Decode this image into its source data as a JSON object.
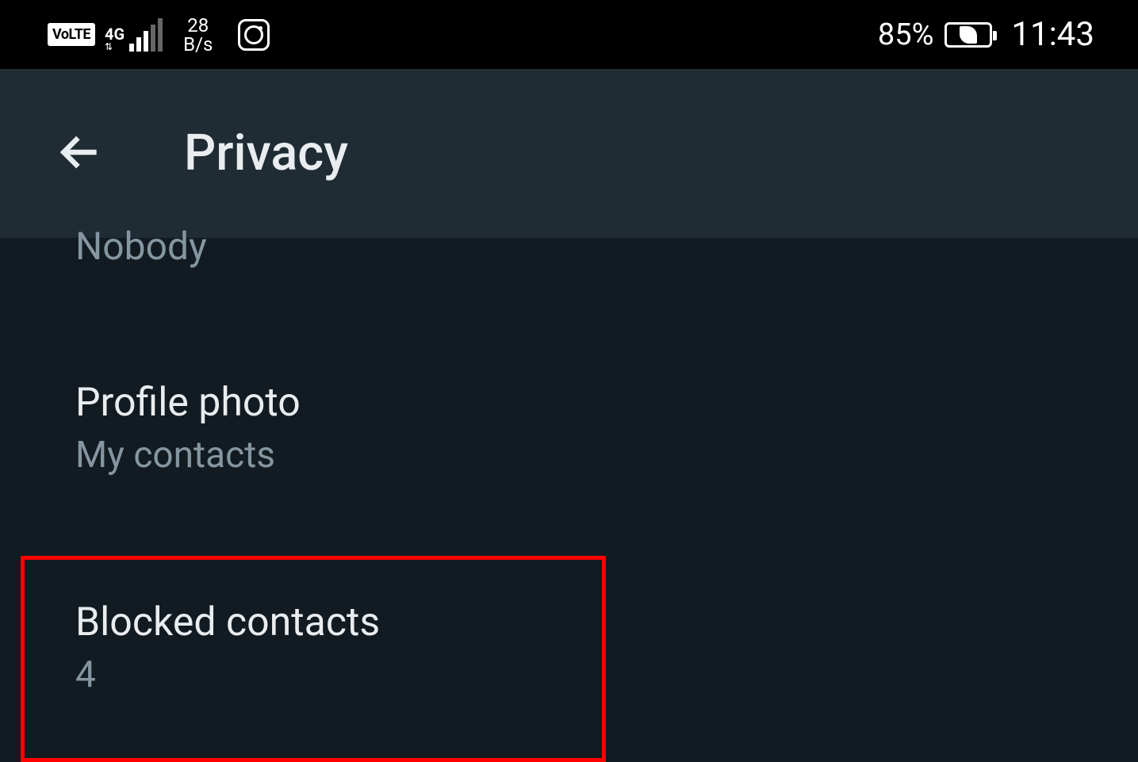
{
  "statusBar": {
    "volte": "VoLTE",
    "networkType": "4G",
    "dataSpeed": "28",
    "dataUnit": "B/s",
    "batteryPercent": "85%",
    "time": "11:43"
  },
  "header": {
    "title": "Privacy"
  },
  "items": {
    "partialTop": {
      "value": "Nobody"
    },
    "profilePhoto": {
      "title": "Profile photo",
      "value": "My contacts"
    },
    "blockedContacts": {
      "title": "Blocked contacts",
      "value": "4"
    }
  }
}
